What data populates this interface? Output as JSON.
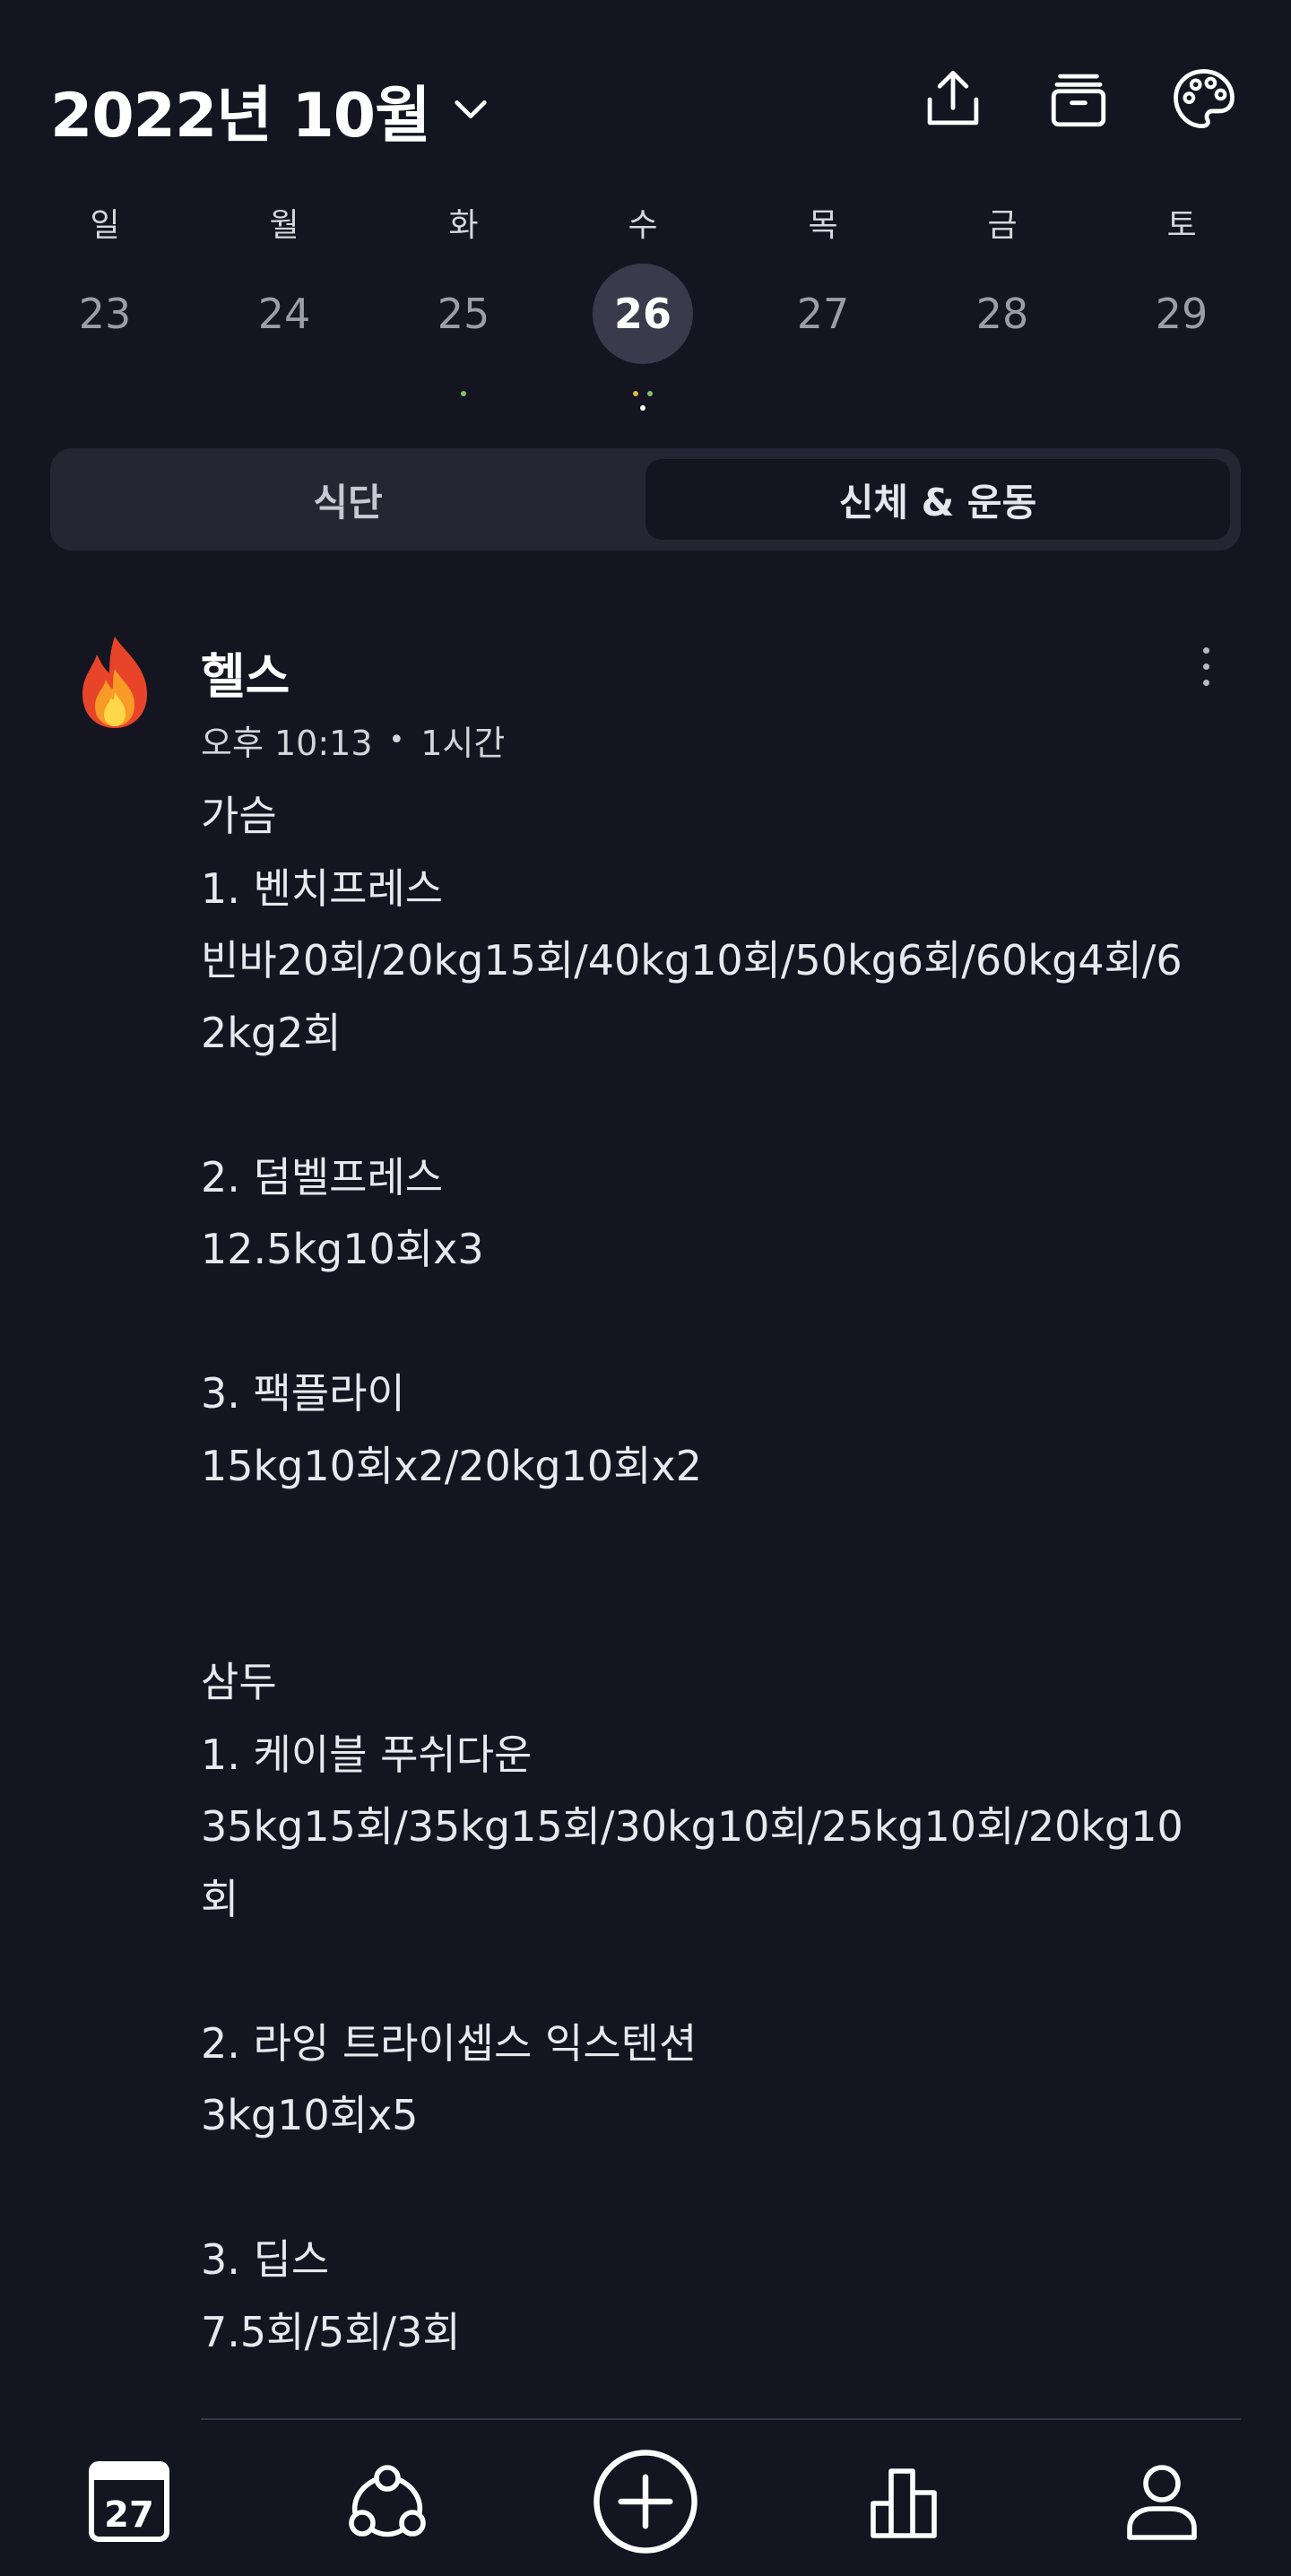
{
  "header": {
    "month_title": "2022년 10월",
    "icons": [
      "share-icon",
      "archive-icon",
      "palette-icon"
    ]
  },
  "week": {
    "days": [
      {
        "dow": "일",
        "date": "23",
        "selected": false,
        "dots": []
      },
      {
        "dow": "월",
        "date": "24",
        "selected": false,
        "dots": []
      },
      {
        "dow": "화",
        "date": "25",
        "selected": false,
        "dots": [
          "#7cc36a"
        ]
      },
      {
        "dow": "수",
        "date": "26",
        "selected": true,
        "dots": [
          "#e2b84a",
          "#7cc36a",
          "#ffffff"
        ]
      },
      {
        "dow": "목",
        "date": "27",
        "selected": false,
        "dots": []
      },
      {
        "dow": "금",
        "date": "28",
        "selected": false,
        "dots": []
      },
      {
        "dow": "토",
        "date": "29",
        "selected": false,
        "dots": []
      }
    ]
  },
  "tabs": {
    "diet": "식단",
    "body_exercise": "신체 & 운동",
    "active": "body_exercise"
  },
  "entry": {
    "icon": "fire-icon",
    "title": "헬스",
    "time": "오후 10:13",
    "separator": "•",
    "duration": "1시간",
    "note": "가슴\n1. 벤치프레스\n빈바20회/20kg15회/40kg10회/50kg6회/60kg4회/62kg2회\n\n2. 덤벨프레스\n12.5kg10회x3\n\n3. 팩플라이\n15kg10회x2/20kg10회x2\n\n\n삼두\n1. 케이블 푸쉬다운\n35kg15회/35kg15회/30kg10회/25kg10회/20kg10회\n\n2. 라잉 트라이셉스 익스텐션\n3kg10회x5\n\n3. 딥스\n7.5회/5회/3회"
  },
  "bottom_nav": {
    "calendar_date": "27",
    "items": [
      "calendar-icon",
      "community-icon",
      "add-icon",
      "stats-icon",
      "profile-icon"
    ]
  },
  "colors": {
    "background": "#151521",
    "segment_bg": "#252634",
    "selected_day_bg": "#3a3a4c"
  }
}
